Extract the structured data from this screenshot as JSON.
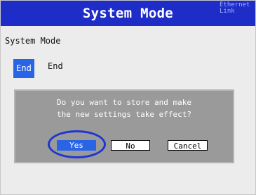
{
  "header": {
    "title": "System Mode",
    "link_status": "Ethernet\nLink"
  },
  "main": {
    "section_label": "System Mode",
    "end_button_label": "End",
    "end_label": "End"
  },
  "dialog": {
    "message": "Do you want to store and make\nthe new settings take effect?",
    "buttons": {
      "yes": "Yes",
      "no": "No",
      "cancel": "Cancel"
    },
    "selected": "yes"
  },
  "colors": {
    "title_bar": "#1e2cc8",
    "selected": "#2a64e6",
    "dialog_bg": "#9a9a9a",
    "highlight_ring": "#1e36d2"
  }
}
